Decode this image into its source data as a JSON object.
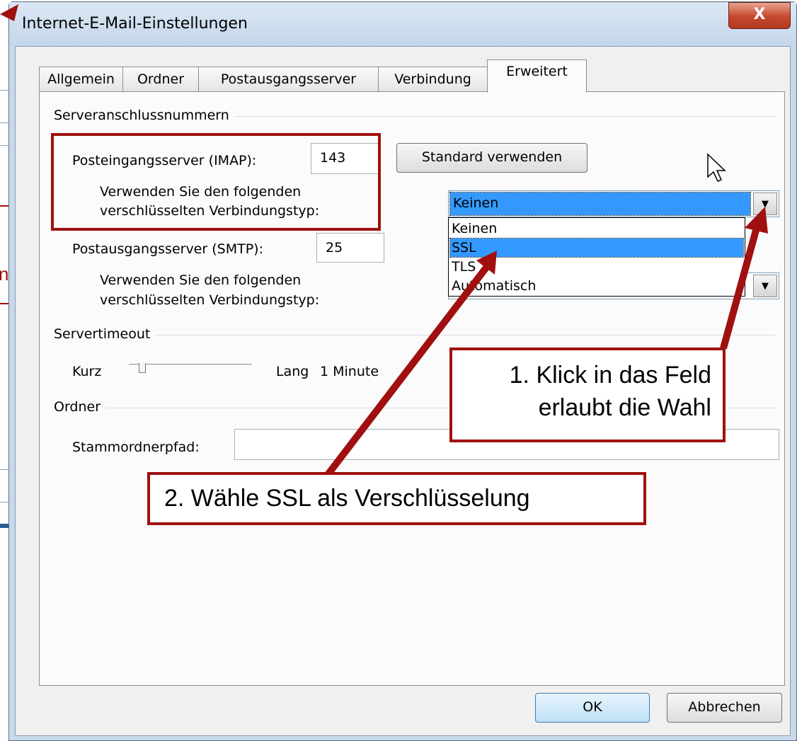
{
  "window": {
    "title": "Internet-E-Mail-Einstellungen",
    "close_label": "X"
  },
  "background": {
    "fragment": "n"
  },
  "tabs": [
    {
      "label": "Allgemein"
    },
    {
      "label": "Ordner"
    },
    {
      "label": "Postausgangsserver"
    },
    {
      "label": "Verbindung"
    },
    {
      "label": "Erweitert",
      "active": true
    }
  ],
  "ports": {
    "group_title": "Serveranschlussnummern",
    "incoming_label": "Posteingangsserver (IMAP):",
    "incoming_value": "143",
    "default_button": "Standard verwenden",
    "enc_label_line1": "Verwenden Sie den folgenden",
    "enc_label_line2": "verschlüsselten Verbindungstyp:",
    "incoming_encryption": "Keinen",
    "outgoing_label": "Postausgangsserver (SMTP):",
    "outgoing_value": "25",
    "outgoing_enc_line1": "Verwenden Sie den folgenden",
    "outgoing_enc_line2": "verschlüsselten Verbindungstyp:",
    "dropdown_options": [
      "Keinen",
      "SSL",
      "TLS",
      "Automatisch"
    ],
    "highlighted_option": "SSL"
  },
  "timeout": {
    "group_title": "Servertimeout",
    "short_label": "Kurz",
    "long_label": "Lang",
    "value": "1 Minute"
  },
  "folders": {
    "group_title": "Ordner",
    "root_label": "Stammordnerpfad:",
    "root_value": ""
  },
  "buttons": {
    "ok": "OK",
    "cancel": "Abbrechen"
  },
  "annotations": {
    "callout1_line1": "1. Klick in das Feld",
    "callout1_line2": "erlaubt die Wahl",
    "callout2": "2. Wähle SSL als Verschlüsselung"
  },
  "colors": {
    "annotation": "#a01010",
    "selection": "#3399ff"
  }
}
